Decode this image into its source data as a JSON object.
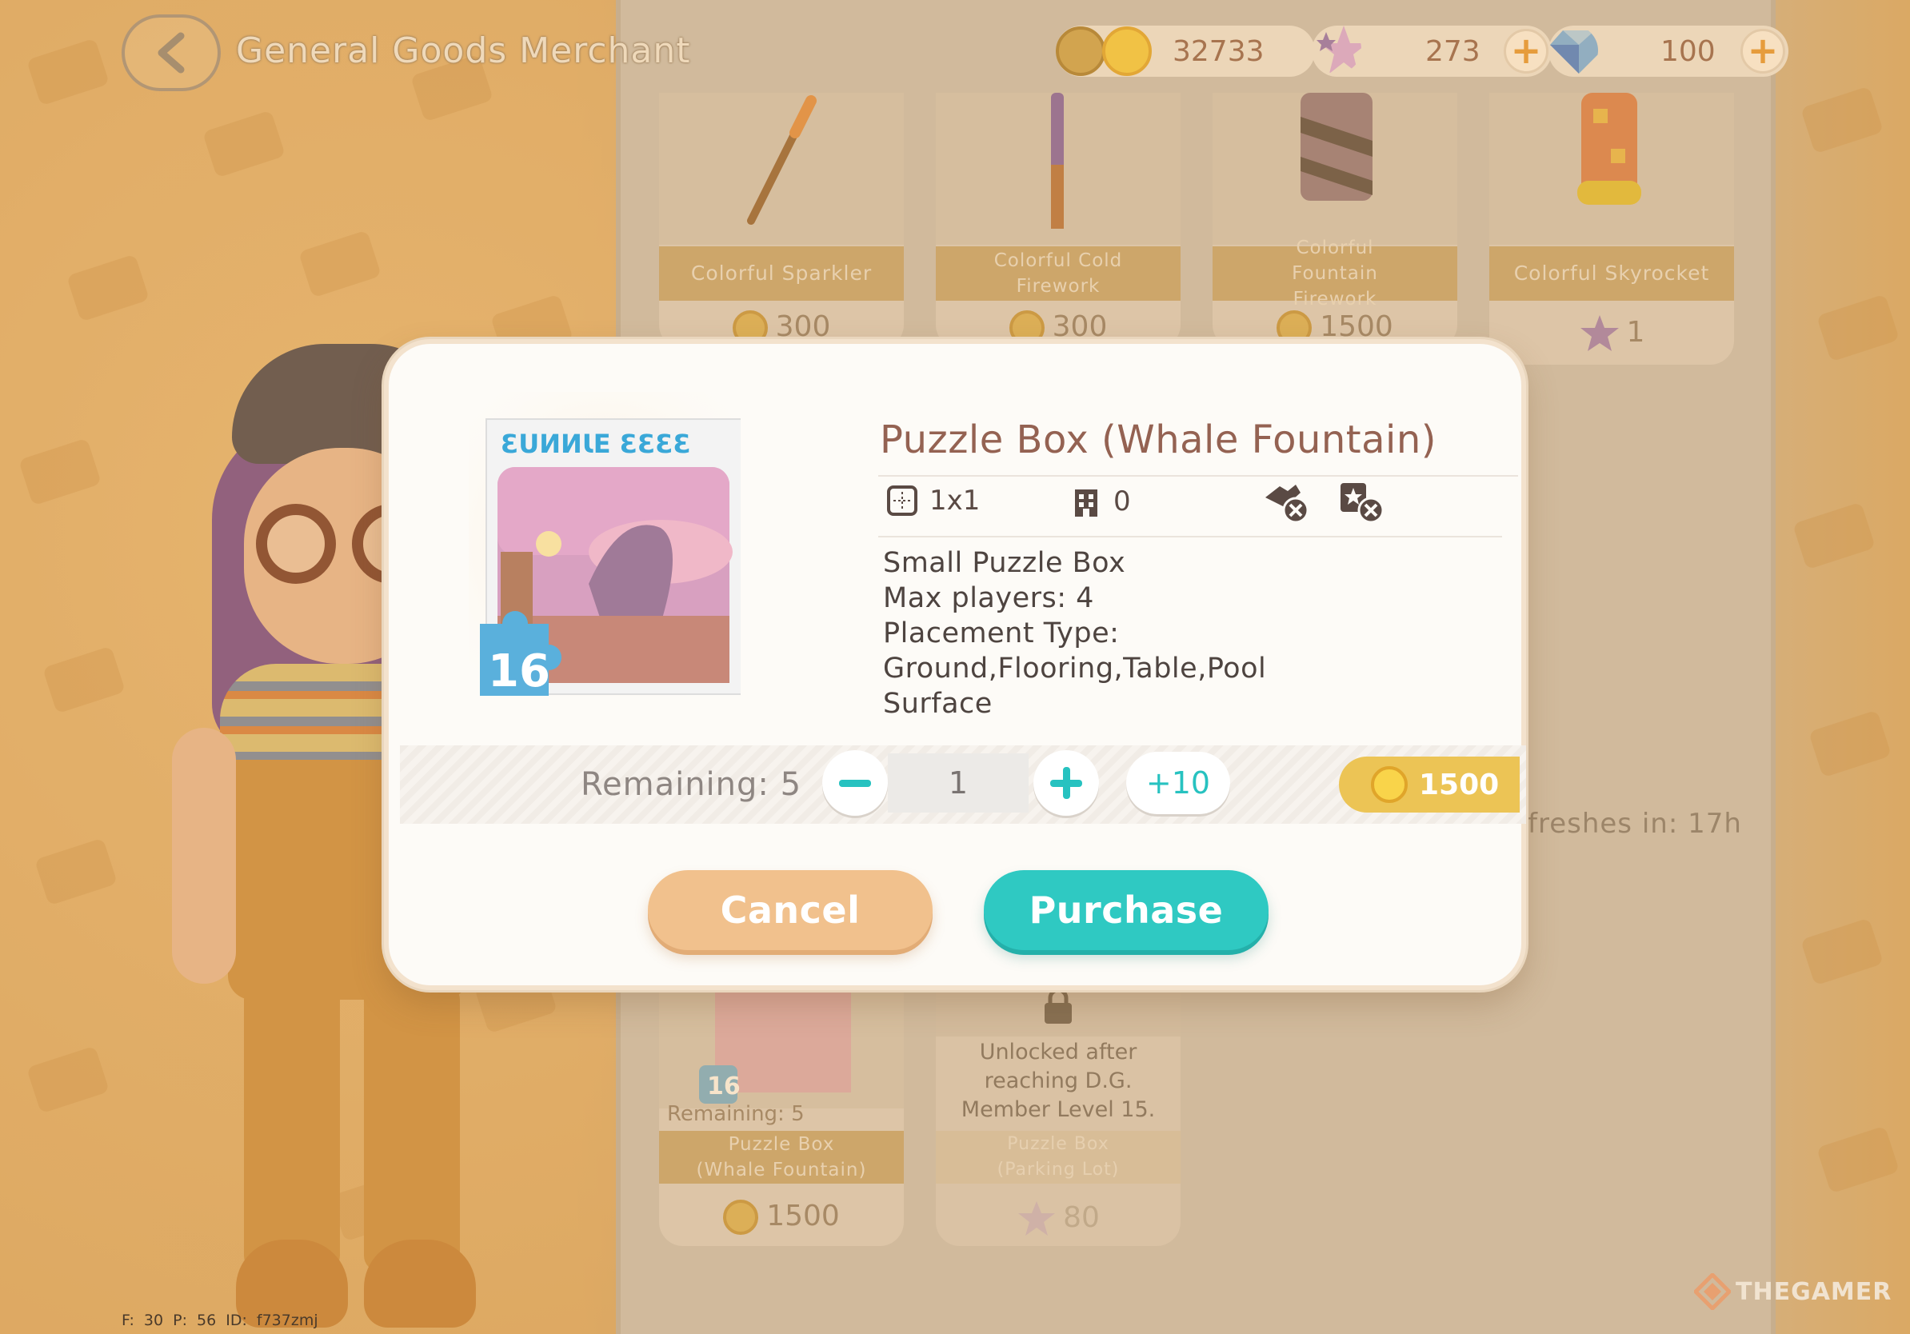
{
  "header": {
    "title": "General Goods Merchant",
    "currencies": {
      "coins": "32733",
      "stars": "273",
      "diamonds": "100"
    }
  },
  "shop": {
    "items": [
      {
        "name": "Colorful Sparkler",
        "price": "300",
        "currency_icon": "coin-icon"
      },
      {
        "name": "Colorful Cold Firework",
        "price": "300",
        "currency_icon": "coin-icon"
      },
      {
        "name": "Colorful Fountain Firework",
        "price": "1500",
        "currency_icon": "coin-icon"
      },
      {
        "name": "Colorful Skyrocket",
        "price": "1",
        "currency_icon": "star-icon"
      },
      {
        "name": "Puzzle Box (Whale Fountain)",
        "price": "1500",
        "remaining": "Remaining: 5",
        "badge": "16",
        "currency_icon": "coin-icon"
      },
      {
        "name": "Puzzle Box (Parking Lot)",
        "price": "80",
        "locked_text": "Unlocked after reaching D.G. Member Level 15.",
        "currency_icon": "star-icon"
      }
    ],
    "refresh_text": "freshes in: 17h"
  },
  "dialog": {
    "title": "Puzzle Box (Whale Fountain)",
    "size": "1x1",
    "capacity": "0",
    "box_label": "ƐUИИƖE ƐƐƐƐ",
    "piece_count": "16",
    "description": [
      "Small Puzzle Box",
      "Max players: 4",
      "Placement Type: Ground,Flooring,Table,Pool",
      "Surface"
    ],
    "remaining": "Remaining: 5",
    "quantity": "1",
    "plus_ten": "+10",
    "total_price": "1500",
    "cancel_label": "Cancel",
    "purchase_label": "Purchase"
  },
  "footer": {
    "debug": "F: 30   P: 56   ID: f737zmj",
    "watermark": "THEGAMER"
  },
  "colors": {
    "accent_teal": "#2fc9c2",
    "cancel_orange": "#f1c18d",
    "price_gold": "#ecc455",
    "title_brown": "#946252"
  }
}
